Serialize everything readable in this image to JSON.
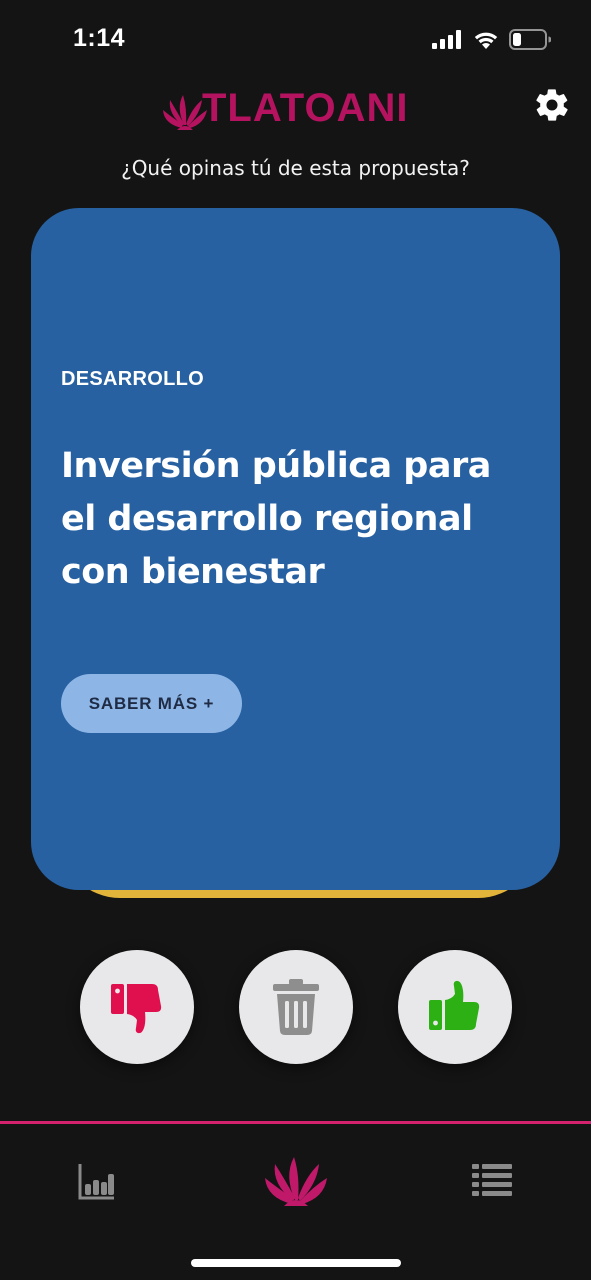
{
  "status_bar": {
    "time": "1:14",
    "icons": [
      "cellular-signal-icon",
      "wifi-icon",
      "battery-icon"
    ]
  },
  "header": {
    "app_name": "TLATOANI",
    "brand_color": "#b5135f",
    "settings_icon": "gear-icon"
  },
  "prompt": "¿Qué opinas tú de esta propuesta?",
  "card": {
    "category": "DESARROLLO",
    "title": "Inversión pública para el desarrollo regional con bienestar",
    "more_label": "SABER MÁS +",
    "background_color": "#2761a1",
    "stack_color": "#e3b43a"
  },
  "actions": [
    {
      "name": "dislike",
      "icon": "thumbs-down-icon",
      "color": "#e0104f"
    },
    {
      "name": "discard",
      "icon": "trash-icon",
      "color": "#8e8e8e"
    },
    {
      "name": "like",
      "icon": "thumbs-up-icon",
      "color": "#2db014"
    }
  ],
  "bottom_nav": {
    "accent_color": "#d4226e",
    "items": [
      {
        "name": "stats",
        "icon": "bar-chart-icon"
      },
      {
        "name": "home",
        "icon": "tlatoani-fan-icon"
      },
      {
        "name": "list",
        "icon": "list-icon"
      }
    ]
  }
}
